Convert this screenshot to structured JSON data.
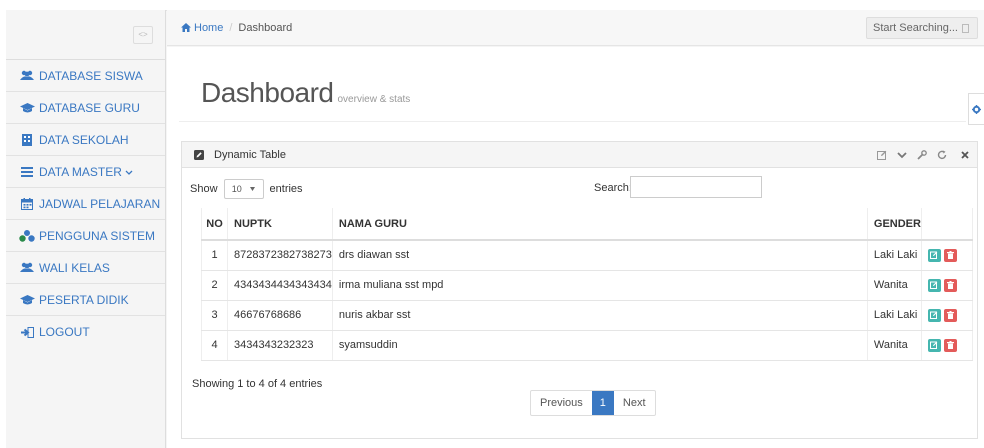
{
  "sidebar": {
    "toggle_glyph": "<>",
    "items": [
      {
        "label": "DATABASE SISWA",
        "icon": "users-icon"
      },
      {
        "label": "DATABASE GURU",
        "icon": "graduation-cap-icon"
      },
      {
        "label": "DATA SEKOLAH",
        "icon": "building-icon"
      },
      {
        "label": "DATA MASTER",
        "icon": "bars-icon",
        "chevron": "⌄"
      },
      {
        "label": "JADWAL PELAJARAN",
        "icon": "calendar-icon"
      },
      {
        "label": "PENGGUNA SISTEM",
        "icon": "sitemap-icon"
      },
      {
        "label": "WALI KELAS",
        "icon": "users-icon"
      },
      {
        "label": "PESERTA DIDIK",
        "icon": "graduation-cap-icon"
      },
      {
        "label": "LOGOUT",
        "icon": "sign-out-icon"
      }
    ]
  },
  "topbar": {
    "breadcrumb_home": "Home",
    "breadcrumb_sep": "/",
    "breadcrumb_current": "Dashboard",
    "search_placeholder": "Start Searching..."
  },
  "page": {
    "title": "Dashboard",
    "subtitle": "overview & stats"
  },
  "portlet": {
    "caption": "Dynamic Table",
    "show_label": "Show",
    "length_value": "10",
    "entries_label": "entries",
    "search_label": "Search:",
    "info": "Showing 1 to 4 of 4 entries",
    "pagination": {
      "previous": "Previous",
      "current": "1",
      "next": "Next"
    }
  },
  "table": {
    "headers": {
      "no": "NO",
      "nuptk": "NUPTK",
      "nama": "NAMA GURU",
      "gender": "GENDER"
    },
    "rows": [
      {
        "no": "1",
        "nuptk": "8728372382738273",
        "nama": "drs diawan sst",
        "gender": "Laki Laki"
      },
      {
        "no": "2",
        "nuptk": "4343434434343434",
        "nama": "irma muliana sst mpd",
        "gender": "Wanita"
      },
      {
        "no": "3",
        "nuptk": "46676768686",
        "nama": "nuris akbar sst",
        "gender": "Laki Laki"
      },
      {
        "no": "4",
        "nuptk": "3434343232323",
        "nama": "syamsuddin",
        "gender": "Wanita"
      }
    ]
  },
  "colors": {
    "accent": "#3a78c2",
    "edit_button": "#45b6af",
    "delete_button": "#e35b5a",
    "sidebar_bg": "#f5f5f5"
  }
}
